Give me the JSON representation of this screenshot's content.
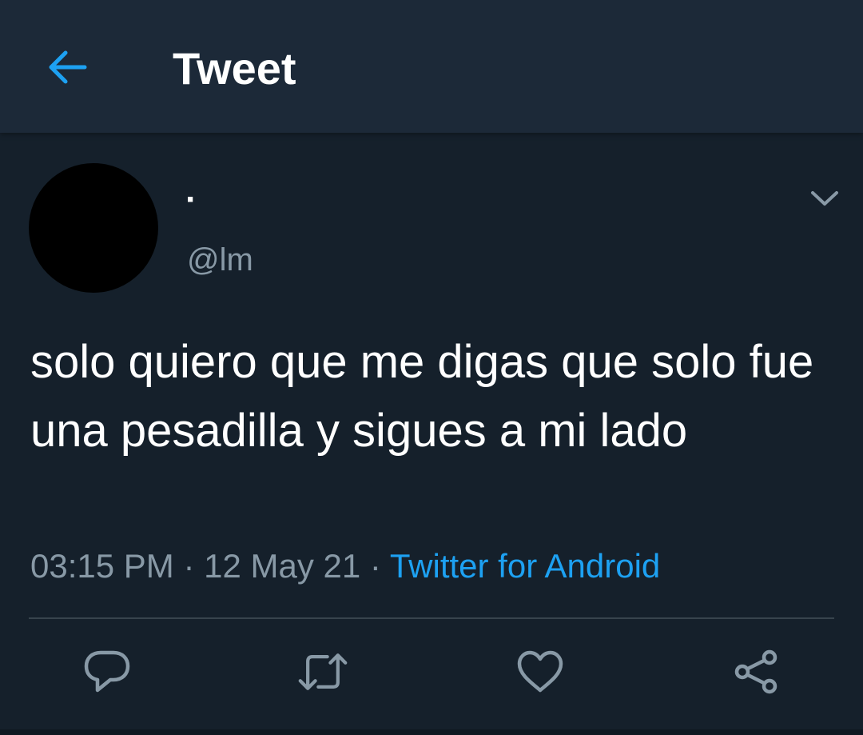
{
  "header": {
    "title": "Tweet",
    "back_icon": "arrow-left-icon"
  },
  "tweet": {
    "author_display_name": "·",
    "author_handle": "@lm",
    "text": "solo quiero que me digas que solo fue una pesadilla y sigues a mi lado",
    "time": "03:15 PM",
    "separator": " · ",
    "date": "12 May 21",
    "source": "Twitter for Android"
  },
  "actions": {
    "reply": "reply-icon",
    "retweet": "retweet-icon",
    "like": "heart-icon",
    "share": "share-icon"
  },
  "colors": {
    "background": "#15202b",
    "header_background": "#1c2938",
    "accent": "#1da1f2",
    "secondary_text": "#8899a6",
    "divider": "#38444d"
  }
}
